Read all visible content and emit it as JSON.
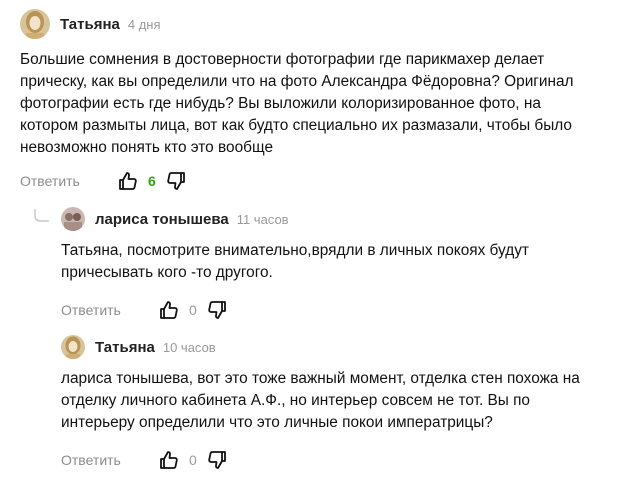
{
  "comments": [
    {
      "author": "Татьяна",
      "time": "4 дня",
      "text_lines": [
        "Большие сомнения в достоверности фотографии где парикмахер делает",
        "прическу, как вы определили что на фото Александра Фёдоровна? Оригинал",
        "фотографии есть где нибудь? Вы выложили колоризированное фото, на",
        "котором размыты лица, вот как будто специально их размазали, чтобы было",
        "невозможно понять кто это вообще"
      ],
      "reply_label": "Ответить",
      "likes": "6"
    },
    {
      "author": "лариса тонышева",
      "time": "11 часов",
      "text_lines": [
        "Татьяна, посмотрите внимательно,врядли в личных покоях будут",
        "причесывать кого -то другого."
      ],
      "reply_label": "Ответить",
      "likes": "0"
    },
    {
      "author": "Татьяна",
      "time": "10 часов",
      "text_lines": [
        "лариса тонышева, вот это тоже важный момент, отделка стен похожа на",
        "отделку личного кабинета А.Ф., но интерьер совсем не тот. Вы по",
        "интерьеру определили что это личные покои императрицы?"
      ],
      "reply_label": "Ответить",
      "likes": "0"
    }
  ],
  "colors": {
    "accent_positive": "#34a00f",
    "muted": "#8c8c8c"
  },
  "icons": [
    "avatar",
    "thumb-up-icon",
    "thumb-down-icon",
    "thread-connector-icon"
  ]
}
